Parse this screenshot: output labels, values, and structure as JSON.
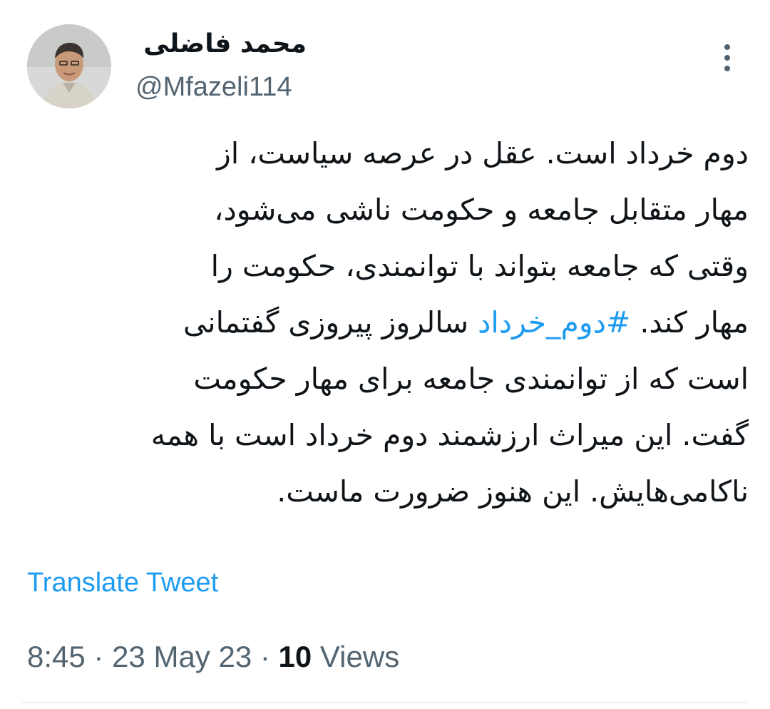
{
  "author": {
    "display_name": "محمد فاضلی",
    "handle": "@Mfazeli114",
    "avatar_icon": "user-avatar-photo"
  },
  "more_icon": "more-vertical-icon",
  "tweet": {
    "lines": [
      [
        "دوم خرداد است. عقل در عرصه سیاست، از"
      ],
      [
        "مهار متقابل جامعه و حکومت ناشی می‌شود،"
      ],
      [
        "وقتی که جامعه بتواند با توانمندی، حکومت را"
      ],
      [
        "مهار کند. ",
        "#دوم_خرداد",
        " سالروز پیروزی گفتمانی"
      ],
      [
        "است که از توانمندی جامعه برای مهار حکومت"
      ],
      [
        "گفت. این میراث ارزشمند دوم خرداد است با همه"
      ],
      [
        "ناکامی‌هایش. این هنوز ضرورت ماست."
      ]
    ],
    "hashtag": "#دوم_خرداد"
  },
  "translate_label": "Translate Tweet",
  "meta": {
    "time": "8:45",
    "separator": " · ",
    "date": "23 May 23",
    "views_count": "10",
    "views_label": " Views"
  },
  "colors": {
    "accent": "#1d9bf0",
    "text": "#0f1419",
    "secondary": "#536471"
  }
}
